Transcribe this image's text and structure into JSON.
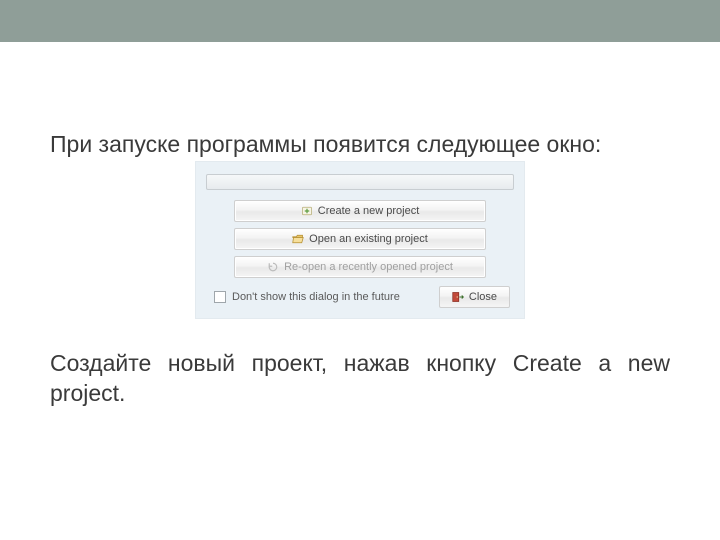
{
  "paragraphs": {
    "intro": "При запуске программы появится следующее окно:",
    "instruction": "Создайте новый проект, нажав кнопку Create a new project."
  },
  "dialog": {
    "buttons": {
      "create": "Create a new project",
      "open": "Open an existing project",
      "reopen": "Re-open a recently opened project",
      "close": "Close"
    },
    "checkbox_label": "Don't show this dialog in the future"
  },
  "icons": {
    "new_project": "new-project-icon",
    "open_project": "open-folder-icon",
    "reopen_project": "reopen-icon",
    "close": "close-door-icon"
  },
  "colors": {
    "topbar": "#8f9e98",
    "dialog_bg": "#eaf1f6"
  }
}
